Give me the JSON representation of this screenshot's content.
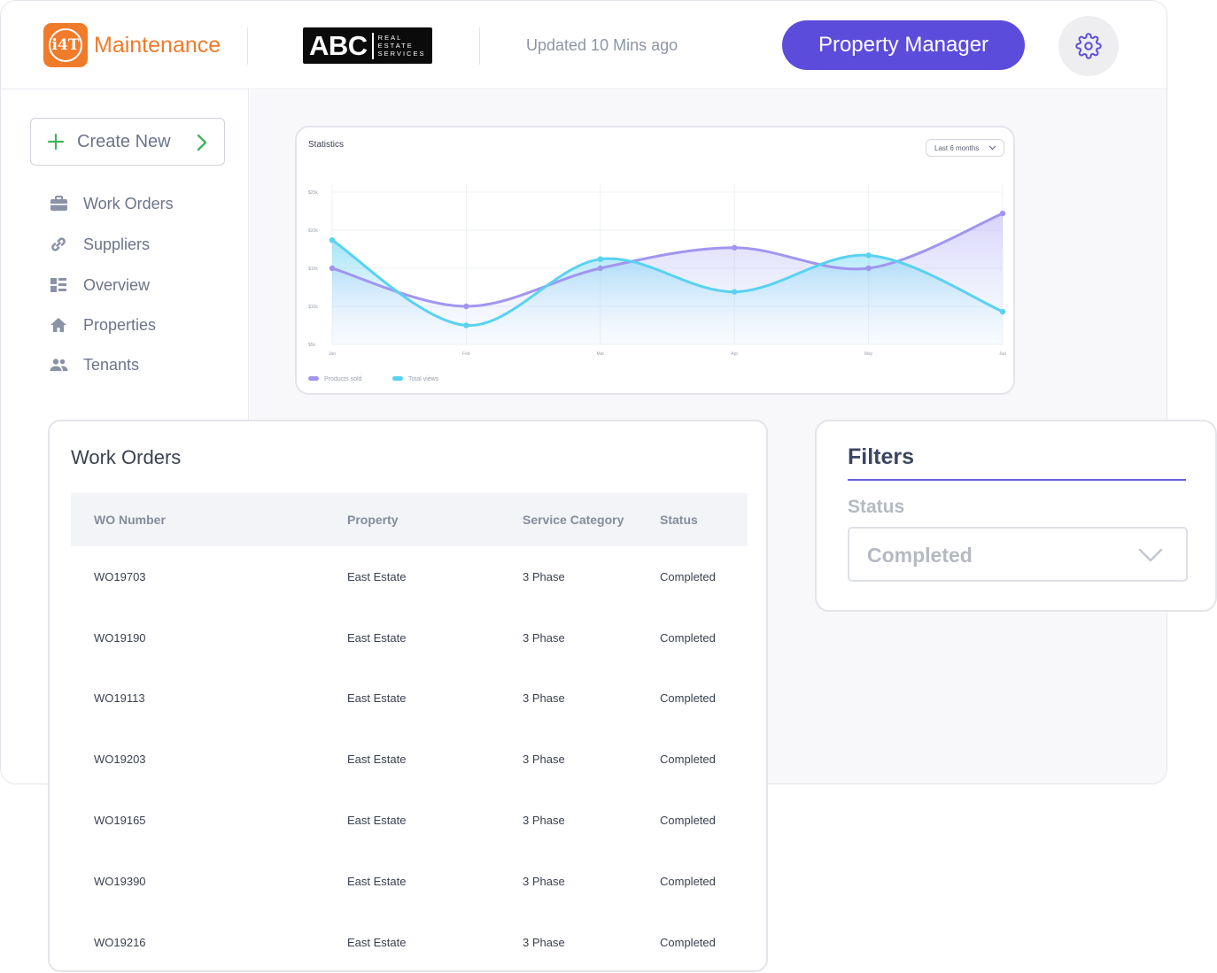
{
  "header": {
    "brand_mark": "i4T",
    "brand_name": "Maintenance",
    "partner_logo": {
      "big": "ABC",
      "lines": [
        "REAL",
        "ESTATE",
        "SERVICES"
      ]
    },
    "updated_text": "Updated 10 Mins ago",
    "role_button_label": "Property Manager",
    "settings_icon": "gear-icon",
    "accent_color": "#5c4cdb",
    "brand_color": "#f07b2a"
  },
  "sidebar": {
    "create_button_label": "Create New",
    "items": [
      {
        "label": "Work Orders",
        "icon": "briefcase-icon"
      },
      {
        "label": "Suppliers",
        "icon": "link-icon"
      },
      {
        "label": "Overview",
        "icon": "dashboard-icon"
      },
      {
        "label": "Properties",
        "icon": "home-icon"
      },
      {
        "label": "Tenants",
        "icon": "people-icon"
      }
    ]
  },
  "statistics": {
    "title": "Statistics",
    "range_label": "Last 6 months"
  },
  "chart_data": {
    "type": "area",
    "categories": [
      "Jan",
      "Feb",
      "Mar",
      "Apr",
      "May",
      "Jun"
    ],
    "y_ticks": [
      "$25k",
      "$20k",
      "$15k",
      "$10k",
      "$5k"
    ],
    "ylim": [
      5,
      25
    ],
    "grid": true,
    "legend_position": "bottom-left",
    "series": [
      {
        "name": "Products sold",
        "color": "#a195f0",
        "values": [
          15.0,
          10.0,
          15.0,
          17.7,
          15.0,
          22.2
        ]
      },
      {
        "name": "Total views",
        "color": "#59d2f1",
        "values": [
          18.7,
          7.5,
          16.2,
          11.9,
          16.7,
          9.3
        ]
      }
    ]
  },
  "work_orders": {
    "title": "Work Orders",
    "columns": [
      "WO Number",
      "Property",
      "Service Category",
      "Status"
    ],
    "rows": [
      [
        "WO19703",
        "East Estate",
        "3 Phase",
        "Completed"
      ],
      [
        "WO19190",
        "East Estate",
        "3 Phase",
        "Completed"
      ],
      [
        "WO19113",
        "East Estate",
        "3 Phase",
        "Completed"
      ],
      [
        "WO19203",
        "East Estate",
        "3 Phase",
        "Completed"
      ],
      [
        "WO19165",
        "East Estate",
        "3 Phase",
        "Completed"
      ],
      [
        "WO19390",
        "East Estate",
        "3 Phase",
        "Completed"
      ],
      [
        "WO19216",
        "East Estate",
        "3 Phase",
        "Completed"
      ]
    ]
  },
  "filters": {
    "title": "Filters",
    "status_label": "Status",
    "status_value": "Completed"
  }
}
